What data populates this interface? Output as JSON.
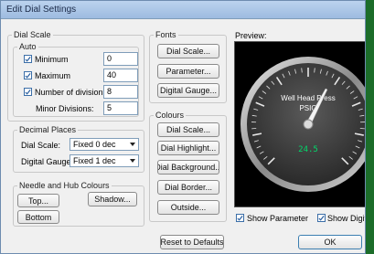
{
  "window": {
    "title": "Edit Dial Settings"
  },
  "dial_scale": {
    "legend": "Dial Scale",
    "auto_legend": "Auto",
    "minimum": {
      "label": "Minimum",
      "value": "0",
      "checked": true
    },
    "maximum": {
      "label": "Maximum",
      "value": "40",
      "checked": true
    },
    "divisions": {
      "label": "Number of divisions:",
      "value": "8",
      "checked": true
    },
    "minor": {
      "label": "Minor Divisions:",
      "value": "5"
    }
  },
  "decimal_places": {
    "legend": "Decimal Places",
    "dial_scale_label": "Dial Scale:",
    "dial_scale_value": "Fixed 0 dec",
    "digital_gauge_label": "Digital Gauge:",
    "digital_gauge_value": "Fixed 1 dec"
  },
  "needle": {
    "legend": "Needle and Hub Colours",
    "top": "Top...",
    "shadow": "Shadow...",
    "bottom": "Bottom"
  },
  "fonts": {
    "legend": "Fonts",
    "dial_scale": "Dial Scale...",
    "parameter": "Parameter...",
    "digital_gauge": "Digital Gauge..."
  },
  "colours": {
    "legend": "Colours",
    "dial_scale": "Dial Scale...",
    "dial_highlight": "Dial Highlight...",
    "dial_background": "Dial Background...",
    "dial_border": "Dial Border...",
    "outside": "Outside..."
  },
  "preview": {
    "label": "Preview:",
    "gauge_title": "Well Head Press",
    "gauge_unit": "PSIG",
    "digital_value": "24.5",
    "show_parameter": {
      "label": "Show Parameter",
      "checked": true
    },
    "show_digital": {
      "label": "Show Digital Ga",
      "checked": true
    }
  },
  "reset_button": "Reset to Defaults",
  "ok_button": "OK",
  "colors": {
    "background_right": "#1c6d2a",
    "window_bg": "#f0f0f0",
    "check_blue": "#2a5fa0",
    "digital_green": "#00d96a"
  }
}
